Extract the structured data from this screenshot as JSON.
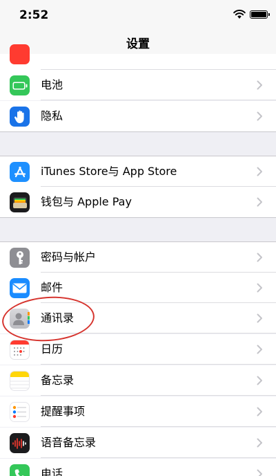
{
  "status_bar": {
    "time": "2:52"
  },
  "nav": {
    "title": "设置"
  },
  "rows": [
    {
      "label": "",
      "icon": "partial-red-icon",
      "color": "#ff3b30"
    },
    {
      "label": "电池",
      "icon": "battery-icon",
      "color": "#34c759"
    },
    {
      "label": "隐私",
      "icon": "hand-icon",
      "color": "#1a73e8"
    },
    {
      "label": "iTunes Store与 App Store",
      "icon": "app-store-icon",
      "color": "#1e90ff"
    },
    {
      "label": "钱包与 Apple Pay",
      "icon": "wallet-icon",
      "color": "#1c1c1e"
    },
    {
      "label": "密码与帐户",
      "icon": "key-icon",
      "color": "#8e8e93"
    },
    {
      "label": "邮件",
      "icon": "mail-icon",
      "color": "#1a8cff"
    },
    {
      "label": "通讯录",
      "icon": "contacts-icon",
      "color": "#c7c7cc"
    },
    {
      "label": "日历",
      "icon": "calendar-icon",
      "color": "#ffffff"
    },
    {
      "label": "备忘录",
      "icon": "notes-icon",
      "color": "#ffd60a"
    },
    {
      "label": "提醒事项",
      "icon": "reminders-icon",
      "color": "#ffffff"
    },
    {
      "label": "语音备忘录",
      "icon": "voice-memos-icon",
      "color": "#1c1c1e"
    },
    {
      "label": "电话",
      "icon": "phone-icon",
      "color": "#34c759"
    }
  ],
  "annotation": {
    "color": "#d6342e",
    "target": "通讯录"
  }
}
